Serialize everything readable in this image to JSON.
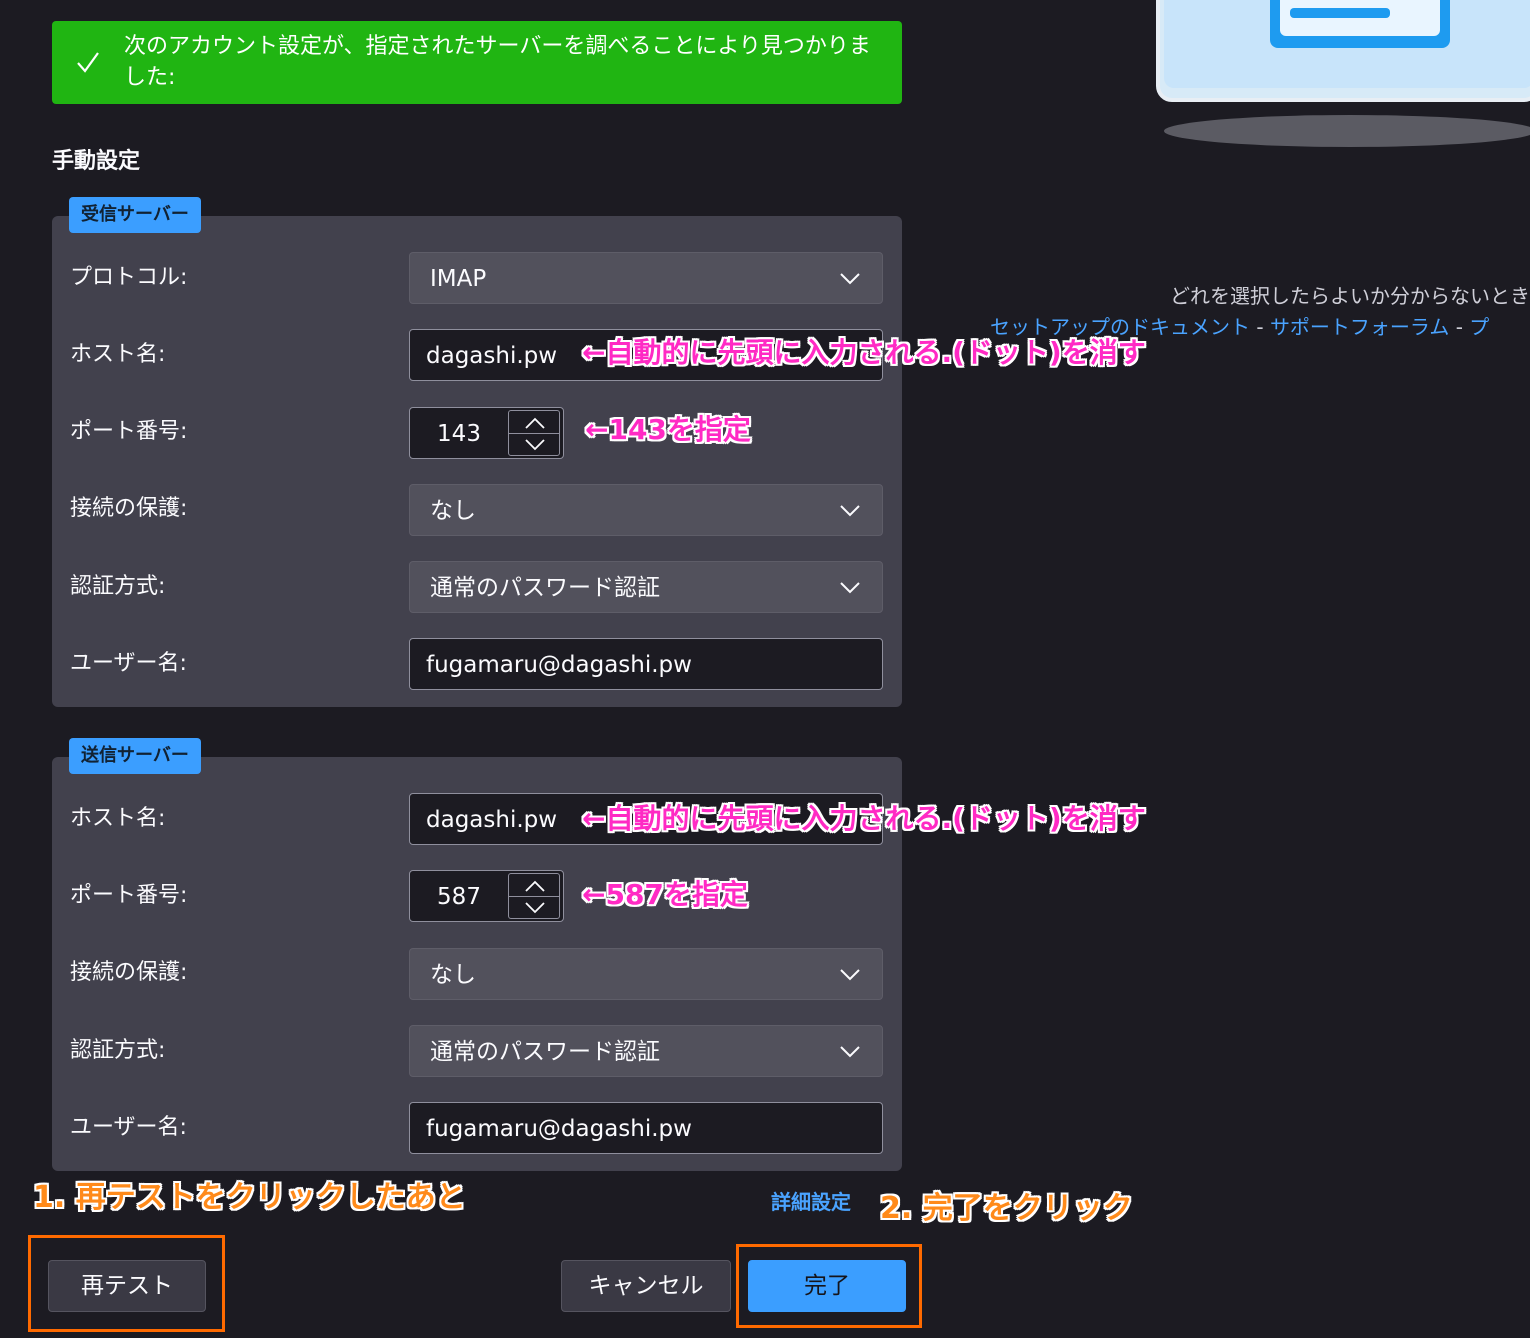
{
  "banner": {
    "message": "次のアカウント設定が、指定されたサーバーを調べることにより見つかりました:"
  },
  "manual_title": "手動設定",
  "incoming": {
    "legend": "受信サーバー",
    "protocol_label": "プロトコル:",
    "protocol_value": "IMAP",
    "host_label": "ホスト名:",
    "host_value": "dagashi.pw",
    "port_label": "ポート番号:",
    "port_value": "143",
    "security_label": "接続の保護:",
    "security_value": "なし",
    "auth_label": "認証方式:",
    "auth_value": "通常のパスワード認証",
    "user_label": "ユーザー名:",
    "user_value": "fugamaru@dagashi.pw"
  },
  "outgoing": {
    "legend": "送信サーバー",
    "host_label": "ホスト名:",
    "host_value": "dagashi.pw",
    "port_label": "ポート番号:",
    "port_value": "587",
    "security_label": "接続の保護:",
    "security_value": "なし",
    "auth_label": "認証方式:",
    "auth_value": "通常のパスワード認証",
    "user_label": "ユーザー名:",
    "user_value": "fugamaru@dagashi.pw"
  },
  "annotations": {
    "incoming_host": "←自動的に先頭に入力される.(ドット)を消す",
    "incoming_port": "←143を指定",
    "outgoing_host": "←自動的に先頭に入力される.(ドット)を消す",
    "outgoing_port": "←587を指定",
    "step1": "1. 再テストをクリックしたあと",
    "step2": "2. 完了をクリック"
  },
  "help": {
    "text": "どれを選択したらよいか分からないとき",
    "link_setup": "セットアップのドキュメント",
    "sep": " - ",
    "link_forum": "サポートフォーラム",
    "link_more": "プ"
  },
  "buttons": {
    "retest": "再テスト",
    "cancel": "キャンセル",
    "done": "完了",
    "advanced": "詳細設定"
  },
  "colors": {
    "banner": "#20b512",
    "accent": "#3b9eff",
    "annotation_pink": "#ff2ac4",
    "annotation_orange": "#ff8a1a",
    "background": "#1c1b22"
  }
}
